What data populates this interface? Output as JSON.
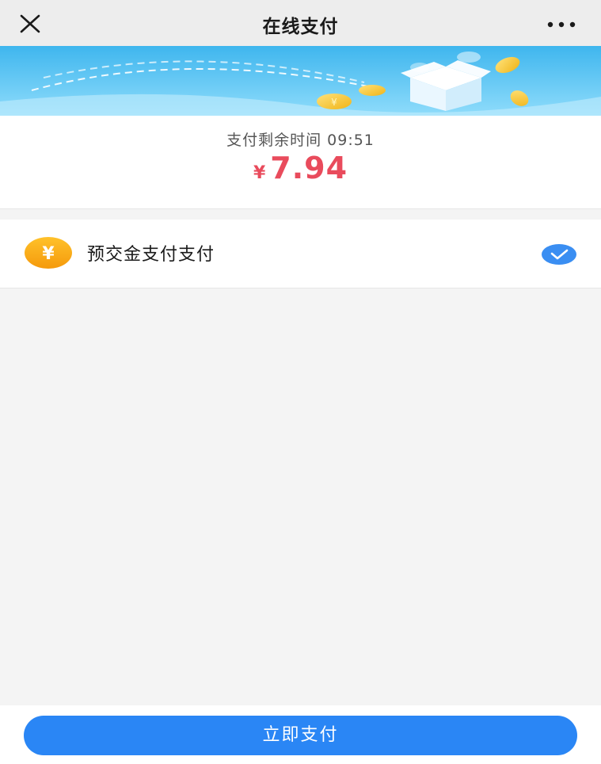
{
  "nav": {
    "title": "在线支付",
    "close_icon": "close-icon",
    "more_icon": "more-icon"
  },
  "banner": {
    "icons": [
      "coin-icon",
      "gift-box-icon",
      "cloud-icon"
    ],
    "colors": {
      "sky_top": "#3fb6ee",
      "sky_bottom": "#8fdcfb",
      "coin": "#f7c41f"
    }
  },
  "payment": {
    "countdown_label": "支付剩余时间",
    "countdown_value": "09:51",
    "currency": "¥",
    "amount": "7.94",
    "amount_color": "#e94b5c"
  },
  "methods": [
    {
      "label": "预交金支付支付",
      "icon": "yuan-coin-icon",
      "selected": true
    }
  ],
  "footer": {
    "pay_button_label": "立即支付",
    "button_color": "#2a86f5"
  }
}
